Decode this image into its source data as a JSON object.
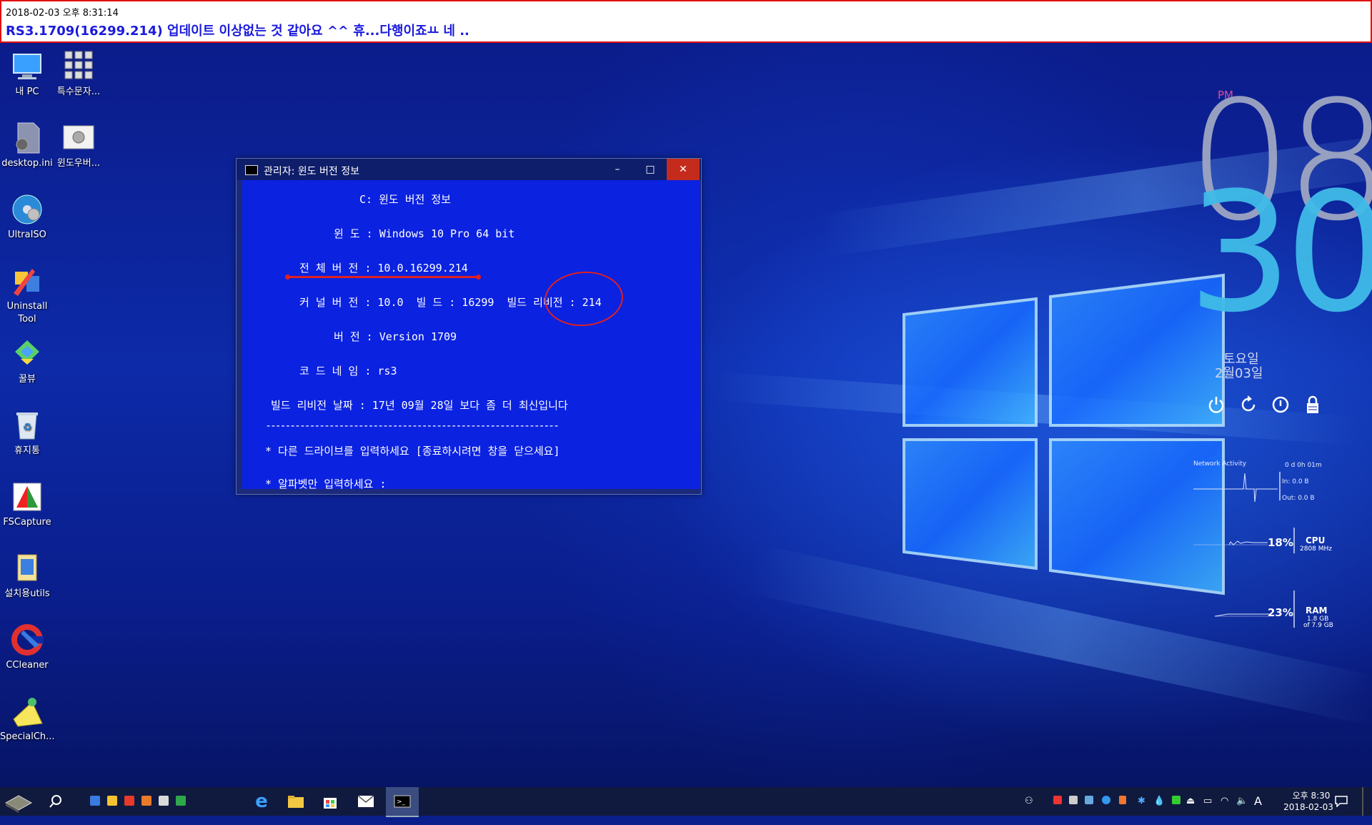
{
  "banner": {
    "datetime": "2018-02-03 오후 8:31:14",
    "title": "RS3.1709(16299.214) 업데이트 이상없는 것 같아요 ^^ 휴...다행이죠ㅛ 네 .."
  },
  "desktop_icons": [
    {
      "label": "내 PC",
      "icon": "computer-icon"
    },
    {
      "label": "특수문자...",
      "icon": "grid-icon"
    },
    {
      "label": "desktop.ini",
      "icon": "settings-file-icon"
    },
    {
      "label": "윈도우버...",
      "icon": "gear-window-icon"
    },
    {
      "label": "UltraISO",
      "icon": "disc-icon"
    },
    {
      "label": "Uninstall Tool",
      "icon": "uninstall-icon"
    },
    {
      "label": "꿀뷰",
      "icon": "honeyview-icon"
    },
    {
      "label": "휴지통",
      "icon": "recycle-bin-icon"
    },
    {
      "label": "FSCapture",
      "icon": "fscapture-icon"
    },
    {
      "label": "설치용utils",
      "icon": "utils-icon"
    },
    {
      "label": "CCleaner",
      "icon": "ccleaner-icon"
    },
    {
      "label": "SpecialCh...",
      "icon": "specialchar-icon"
    }
  ],
  "cmd_window": {
    "title": "관리자:  윈도 버전 정보",
    "minimize": "–",
    "maximize": "□",
    "close": "✕",
    "lines": [
      "C: 윈도 버전 정보",
      "윈 도 : Windows 10 Pro 64 bit",
      "전 체 버 전 : 10.0.16299.214",
      "커 널 버 전 : 10.0  빌 드 : 16299  빌드 리비전 : 214",
      "버 전 : Version 1709",
      "코 드 네 임 : rs3",
      "빌드 리비전 날짜 : 17년 09월 28일 보다 좀 더 최신입니다",
      "------------------------------------------------------------",
      "* 다른 드라이브를 입력하세요 [종료하시려면 창을 닫으세요]",
      "* 알파벳만 입력하세요 :"
    ]
  },
  "clock": {
    "ampm": "PM",
    "hour": "08",
    "minute": "30",
    "weekday": "토요일",
    "date": "2월03일",
    "colors": {
      "pm": "#e04a9a",
      "hour": "#9ea6c2",
      "minute": "#3fbbe8"
    }
  },
  "power_icons": [
    "power-icon",
    "restart-icon",
    "shutdown-icon",
    "lock-icon"
  ],
  "network": {
    "title": "Network Activity",
    "uptime": "0 d 0h 01m",
    "in": "In: 0.0 B",
    "out": "Out: 0.0 B"
  },
  "cpu": {
    "percent": "18%",
    "label": "CPU",
    "freq": "2808 MHz",
    "value": 18
  },
  "ram": {
    "percent": "23%",
    "label": "RAM",
    "used": "1.8 GB",
    "total": "of 7.9 GB",
    "value": 23
  },
  "taskbar": {
    "time": "오후 8:30",
    "date": "2018-02-03",
    "input_indicator": "A"
  }
}
